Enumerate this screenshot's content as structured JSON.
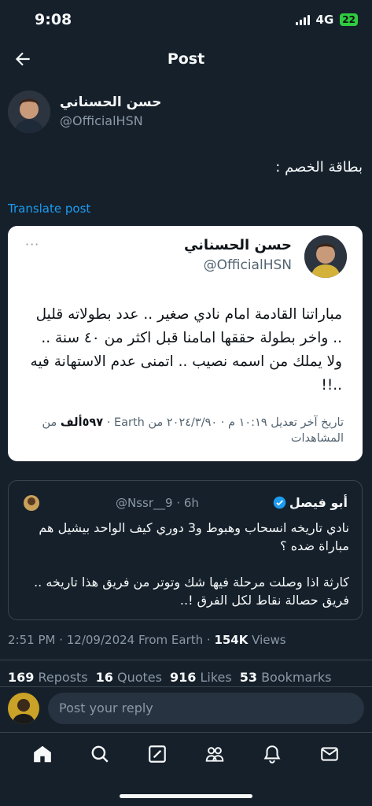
{
  "status_bar": {
    "time": "9:08",
    "network": "4G",
    "battery": "22"
  },
  "header": {
    "title": "Post"
  },
  "author": {
    "name": "حسن الحسناني",
    "handle": "@OfficialHSN"
  },
  "post": {
    "text": "بطاقة الخصم :",
    "translate_label": "Translate post"
  },
  "screenshot_card": {
    "name": "حسن الحسناني",
    "handle": "@OfficialHSN",
    "more": "···",
    "body": "مباراتنا القادمة امام نادي صغير .. عدد بطولاته قليل .. واخر بطولة حققها امامنا قبل اكثر من ٤٠ سنة .. ولا يملك من اسمه نصيب .. اتمنى عدم الاستهانة فيه ..!!",
    "meta_prefix": "تاريخ آخر تعديل ١٠:١٩ م · ٢٠٢٤/٣/٩٠ من Earth · ",
    "meta_views": "٥٩٧ألف",
    "meta_suffix": " من المشاهدات"
  },
  "quote": {
    "name": "أبو فيصل",
    "handle_time": "@Nssr__9 · 6h",
    "verified_color": "#1d9bf0",
    "text1": "نادي تاريخه انسحاب وهبوط و3 دوري كيف الواحد بيشيل هم مباراة ضده ؟",
    "text2": "كارثة اذا وصلت مرحلة فيها شك وتوتر من فريق هذا تاريخه .. فريق حصالة نقاط لكل الفرق !.."
  },
  "timestamp": {
    "text": "2:51 PM · 12/09/2024 From Earth · ",
    "views_count": "154K",
    "views_label": " Views"
  },
  "stats": [
    {
      "count": "169",
      "label": "Reposts"
    },
    {
      "count": "16",
      "label": "Quotes"
    },
    {
      "count": "916",
      "label": "Likes"
    },
    {
      "count": "53",
      "label": "Bookmarks"
    }
  ],
  "reply": {
    "placeholder": "Post your reply"
  },
  "nav": [
    "home-icon",
    "search-icon",
    "grok-icon",
    "communities-icon",
    "notifications-icon",
    "messages-icon"
  ],
  "colors": {
    "background": "#15202b",
    "accent": "#1d9bf0",
    "muted": "#8b98a5"
  }
}
